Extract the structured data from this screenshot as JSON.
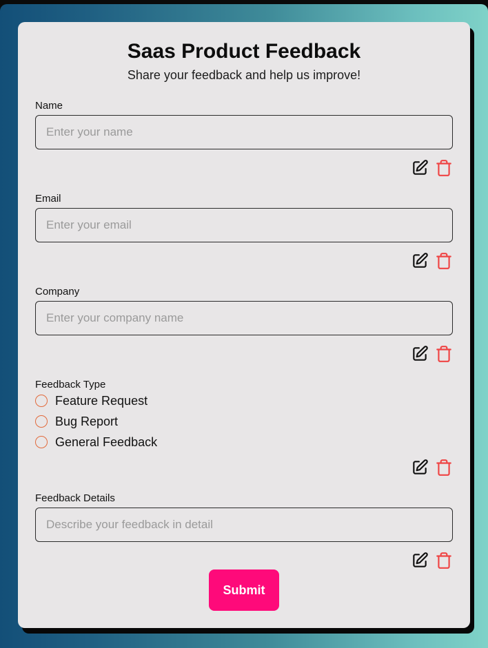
{
  "form": {
    "title": "Saas Product Feedback",
    "subtitle": "Share your feedback and help us improve!",
    "fields": {
      "name": {
        "label": "Name",
        "placeholder": "Enter your name",
        "value": ""
      },
      "email": {
        "label": "Email",
        "placeholder": "Enter your email",
        "value": ""
      },
      "company": {
        "label": "Company",
        "placeholder": "Enter your company name",
        "value": ""
      },
      "feedback_type": {
        "label": "Feedback Type",
        "options": [
          "Feature Request",
          "Bug Report",
          "General Feedback"
        ],
        "selected": null
      },
      "feedback_details": {
        "label": "Feedback Details",
        "placeholder": "Describe your feedback in detail",
        "value": ""
      }
    },
    "submit_label": "Submit"
  },
  "icons": {
    "edit": "edit-icon",
    "delete": "trash-icon"
  },
  "colors": {
    "accent": "#fe0a7a",
    "delete_icon": "#ef4444",
    "radio_border": "#e26a3c",
    "card_background": "#e8e6e7",
    "gradient_start": "#134f78",
    "gradient_end": "#7fd2c8"
  }
}
